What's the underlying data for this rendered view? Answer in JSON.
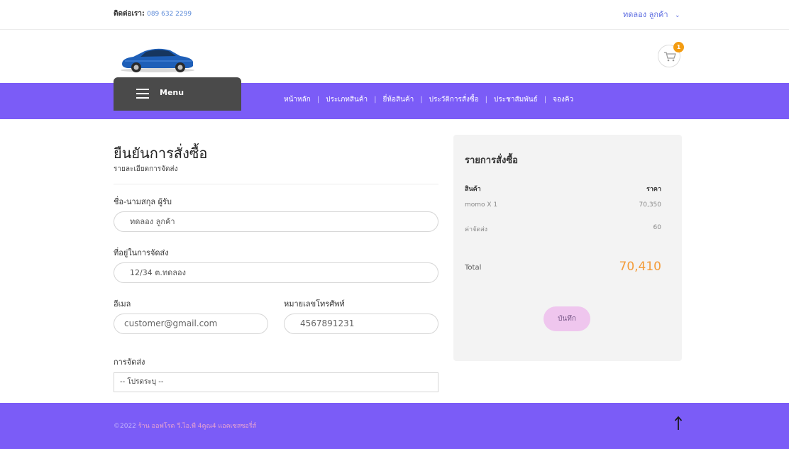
{
  "topbar": {
    "contact_label": "ติดต่อเรา:",
    "contact_phone": "089 632 2299",
    "user_name": "ทดลอง ลูกค้า"
  },
  "cart": {
    "count": "1"
  },
  "nav": {
    "menu_label": "Menu",
    "links": [
      "หน้าหลัก",
      "ประเภทสินค้า",
      "ยี่ห้อสินค้า",
      "ประวัติการสั่งซื้อ",
      "ประชาสัมพันธ์",
      "จองคิว"
    ]
  },
  "form": {
    "title": "ยืนยันการสั่งซื้อ",
    "subtitle": "รายละเอียดการจัดส่ง",
    "name_label": "ชื่อ-นามสกุล ผู้รับ",
    "name_value": "ทดลอง ลูกค้า",
    "address_label": "ที่อยู่ในการจัดส่ง",
    "address_value": "12/34 ต.ทดลอง",
    "email_label": "อีเมล",
    "email_value": "customer@gmail.com",
    "phone_label": "หมายเลขโทรศัพท์",
    "phone_value": "4567891231",
    "shipping_label": "การจัดส่ง",
    "shipping_selected": "-- โปรดระบุ --"
  },
  "summary": {
    "title": "รายการสั่งซื้อ",
    "col_product": "สินค้า",
    "col_price": "ราคา",
    "item_name": "momo X 1",
    "item_price": "70,350",
    "shipping_name": "ค่าจัดส่ง",
    "shipping_price": "60",
    "total_label": "Total",
    "total_value": "70,410",
    "save_label": "บันทึก"
  },
  "footer": {
    "copyright": "©2022",
    "shop_name": "ร้าน ออฟโรด วี.ไอ.พี 4คูณ4 แอคเซสซอรี่ส์"
  },
  "colors": {
    "brand_purple": "#7b5cf7",
    "accent_orange": "#f39c3a",
    "save_button": "#efc6ee",
    "menu_dark": "#4a4a4a"
  },
  "icons": {
    "logo": "blue-car-logo",
    "cart": "shopping-cart-icon",
    "menu": "hamburger-icon",
    "user_menu": "chevron-down-icon",
    "to_top": "arrow-up-icon"
  }
}
